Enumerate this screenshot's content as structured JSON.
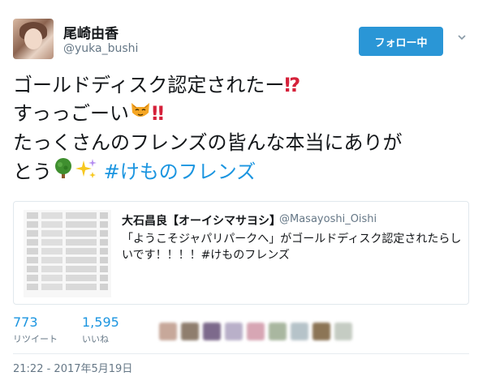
{
  "author": {
    "name": "尾崎由香",
    "handle": "@yuka_bushi"
  },
  "header": {
    "follow_label": "フォロー中",
    "menu_icon": "chevron-down-icon"
  },
  "tweet": {
    "line1_text": "ゴールドディスク認定されたー",
    "line1_mark": "⁉",
    "line2_text": "すっっごーい",
    "line2_emoji": "cat-face-emoji",
    "line2_mark": "‼",
    "line3_text": "たっくさんのフレンズの皆んな本当にありが",
    "line4_text": "とう",
    "line4_emoji1": "tree-emoji",
    "line4_emoji2": "sparkles-emoji",
    "hashtag": "#けものフレンズ"
  },
  "quoted": {
    "author": "大石昌良【オーイシマサヨシ】",
    "handle": "@Masayoshi_Oishi",
    "text": "「ようこそジャパリパークへ」がゴールドディスク認定されたらしいです！！！！#けものフレンズ"
  },
  "stats": {
    "retweets": "773",
    "retweets_label": "リツイート",
    "likes": "1,595",
    "likes_label": "いいね"
  },
  "colors": {
    "accent": "#1b95e0",
    "follow_button": "#2a96d6",
    "exclaim": "#d5213a"
  },
  "timestamp": "21:22 - 2017年5月19日"
}
